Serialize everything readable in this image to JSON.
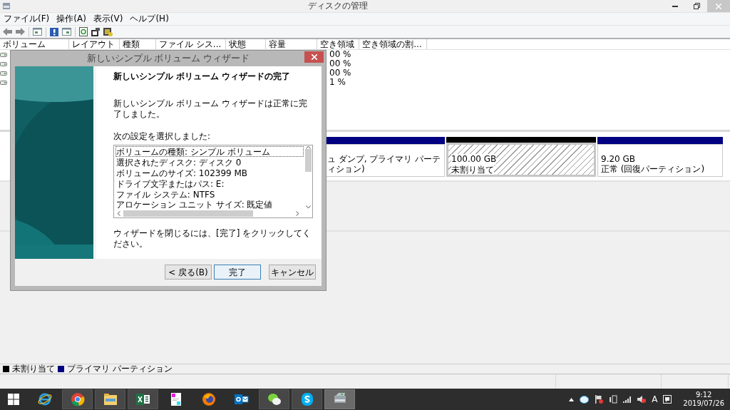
{
  "window": {
    "title": "ディスクの管理"
  },
  "menu": [
    "ファイル(F)",
    "操作(A)",
    "表示(V)",
    "ヘルプ(H)"
  ],
  "volume_table": {
    "columns": [
      "ボリューム",
      "レイアウト",
      "種類",
      "ファイル シス...",
      "状態",
      "容量",
      "空き領域",
      "空き領域の割..."
    ],
    "rows": [
      {
        "free_percent": "00 %"
      },
      {
        "free_percent": "00 %"
      },
      {
        "free_percent": "00 %"
      },
      {
        "free_percent": "1 %"
      }
    ]
  },
  "disks": [
    {
      "partitions": [
        {
          "kind": "primary",
          "lines": [
            "ュ ダンプ, プライマリ パーティション)"
          ]
        },
        {
          "kind": "unallocated",
          "lines": [
            "100.00 GB",
            "未割り当て"
          ]
        },
        {
          "kind": "primary",
          "lines": [
            "9.20 GB",
            "正常 (回復パーティション)"
          ]
        }
      ]
    }
  ],
  "legend": [
    {
      "label": "未割り当て",
      "color": "#000000"
    },
    {
      "label": "プライマリ パーティション",
      "color": "#000080"
    }
  ],
  "dialog": {
    "title": "新しいシンプル ボリューム ウィザード",
    "heading": "新しいシンプル ボリューム ウィザードの完了",
    "message": "新しいシンプル ボリューム ウィザードは正常に完了しました。",
    "list_label": "次の設定を選択しました:",
    "list_items": [
      {
        "text": "ボリュームの種類: シンプル ボリューム",
        "focused": true
      },
      {
        "text": "選択されたディスク: ディスク 0",
        "focused": false
      },
      {
        "text": "ボリュームのサイズ: 102399 MB",
        "focused": false
      },
      {
        "text": "ドライブ文字またはパス: E:",
        "focused": false
      },
      {
        "text": "ファイル システム: NTFS",
        "focused": false
      },
      {
        "text": "アロケーション ユニット サイズ: 既定値",
        "focused": false
      }
    ],
    "footer_note": "ウィザードを閉じるには、[完了] をクリックしてください。",
    "buttons": [
      {
        "label": "< 戻る(B)",
        "default": false
      },
      {
        "label": "完了",
        "default": true
      },
      {
        "label": "キャンセル",
        "default": false
      }
    ]
  },
  "taskbar": {
    "apps": [
      {
        "kind": "ie",
        "running": false,
        "selected": false
      },
      {
        "kind": "chrome",
        "running": true,
        "selected": false
      },
      {
        "kind": "explorer",
        "running": true,
        "selected": false
      },
      {
        "kind": "excel",
        "running": true,
        "selected": false
      },
      {
        "kind": "notes",
        "running": false,
        "selected": false
      },
      {
        "kind": "firefox",
        "running": false,
        "selected": false
      },
      {
        "kind": "outlook",
        "running": false,
        "selected": false
      },
      {
        "kind": "wechat",
        "running": true,
        "selected": false
      },
      {
        "kind": "skype",
        "running": true,
        "selected": false
      },
      {
        "kind": "diskmgmt",
        "running": true,
        "selected": true
      }
    ],
    "ime": "A",
    "time": "9:12",
    "date": "2019/07/26"
  }
}
